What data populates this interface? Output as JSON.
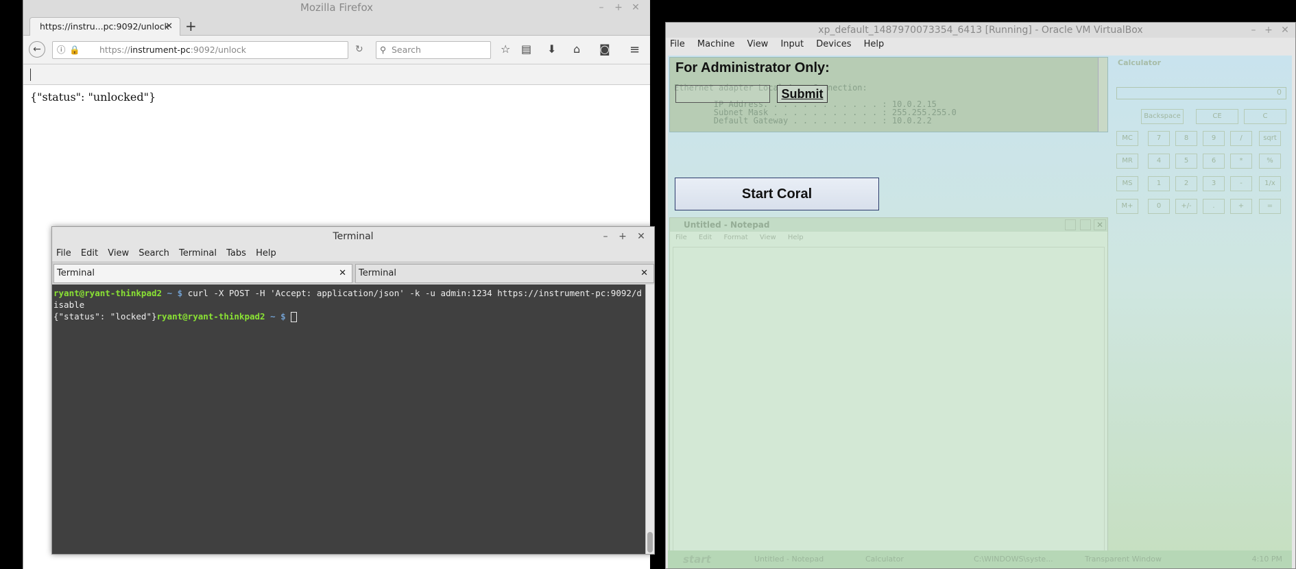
{
  "firefox": {
    "window_title": "Mozilla Firefox",
    "tab_title": "https://instru...pc:9092/unlock",
    "url_prefix": "https://",
    "url_host": "instrument-pc",
    "url_rest": ":9092/unlock",
    "search_placeholder": "Search",
    "page_text": "{\"status\": \"unlocked\"}"
  },
  "terminal": {
    "window_title": "Terminal",
    "menu": [
      "File",
      "Edit",
      "View",
      "Search",
      "Terminal",
      "Tabs",
      "Help"
    ],
    "tabs": [
      "Terminal",
      "Terminal"
    ],
    "prompt_user": "ryant@ryant-thinkpad2",
    "prompt_dir": "~ $",
    "command": "curl -X POST -H 'Accept: application/json' -k -u admin:1234 https://instrument-pc:9092/disable",
    "output": "{\"status\": \"locked\"}"
  },
  "vbox": {
    "window_title": "xp_default_1487970073354_6413 [Running] - Oracle VM VirtualBox",
    "menu": [
      "File",
      "Machine",
      "View",
      "Input",
      "Devices",
      "Help"
    ],
    "admin_heading": "For Administrator Only:",
    "submit_label": "Submit",
    "start_button_label": "Start Coral",
    "console_lines": [
      "Ethernet adapter Local Area Connection:",
      "",
      "        IP Address. . . . . . . . . . . . : 10.0.2.15",
      "        Subnet Mask . . . . . . . . . . . : 255.255.255.0",
      "        Default Gateway . . . . . . . . . : 10.0.2.2"
    ],
    "calculator": {
      "title": "Calculator",
      "display": "0",
      "top_buttons": [
        "Backspace",
        "CE",
        "C"
      ],
      "rows": [
        [
          "MC",
          "7",
          "8",
          "9",
          "/",
          "sqrt"
        ],
        [
          "MR",
          "4",
          "5",
          "6",
          "*",
          "%"
        ],
        [
          "MS",
          "1",
          "2",
          "3",
          "-",
          "1/x"
        ],
        [
          "M+",
          "0",
          "+/-",
          ".",
          "+",
          "="
        ]
      ]
    },
    "notepad": {
      "title": "Untitled - Notepad",
      "menu": [
        "File",
        "Edit",
        "Format",
        "View",
        "Help"
      ]
    },
    "taskbar": {
      "start": "start",
      "tasks": [
        "Untitled - Notepad",
        "Calculator",
        "C:\\WINDOWS\\syste...",
        "Transparent Window"
      ],
      "clock": "4:10 PM"
    }
  }
}
